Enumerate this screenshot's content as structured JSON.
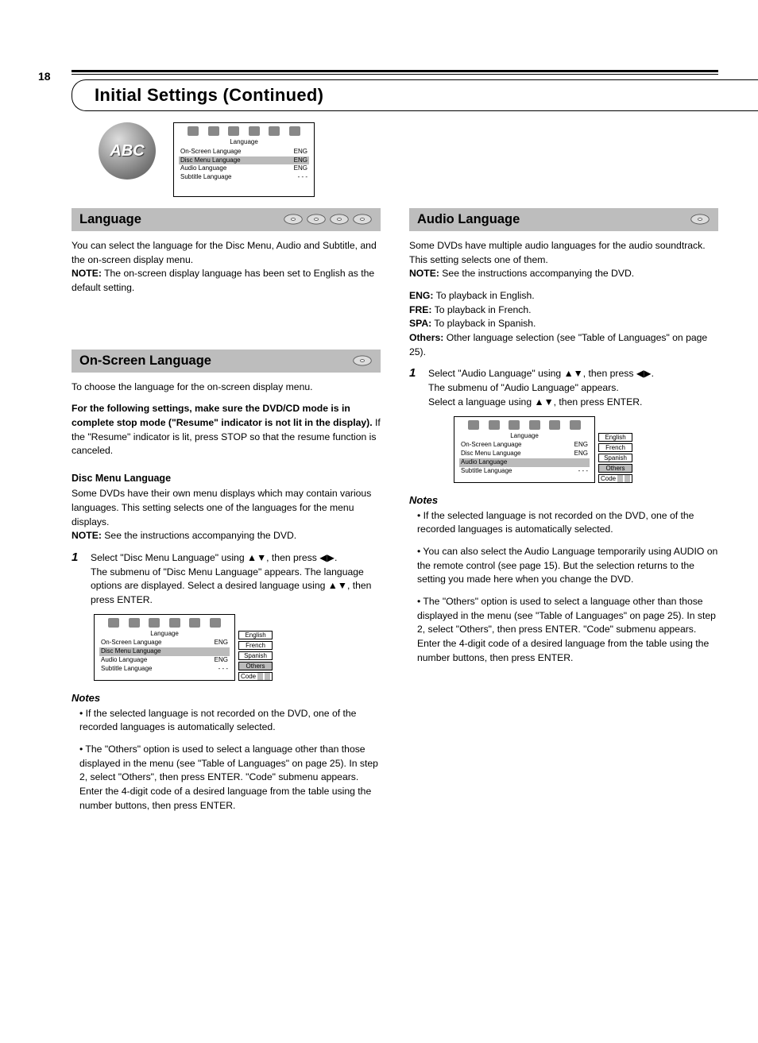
{
  "page_number": "18",
  "section_header": "Initial Settings (Continued)",
  "icon_panel": {
    "abc_label": "ABC",
    "caption": "Language",
    "rows": [
      {
        "label": "On-Screen Language",
        "val": "ENG",
        "hl": false
      },
      {
        "label": "Disc Menu Language",
        "val": "ENG",
        "hl": true
      },
      {
        "label": "Audio Language",
        "val": "ENG",
        "hl": false
      },
      {
        "label": "Subtitle Language",
        "val": "- - -",
        "hl": false
      }
    ]
  },
  "left": {
    "bar1": {
      "title": "Language",
      "categories": 4
    },
    "p1_a": "You can select the language for the Disc Menu, Audio and Subtitle, and the on-screen display menu.",
    "p1_b": "NOTE:",
    "p1_c": " The on-screen display language has been set to English as the default setting.",
    "bar2": {
      "title": "On-Screen Language",
      "categories": 1
    },
    "p2": "To choose the language for the on-screen display menu.",
    "warn_bold1": "For the following settings, make sure the DVD/CD mode is in complete stop mode (\"Resume\" indicator is not lit in the display).",
    "warn_bold2": " If the \"Resume\" indicator is lit, press STOP so that the resume function is canceled.",
    "disc_menu_title": "Disc Menu Language",
    "disc_menu_desc_a": "Some DVDs have their own menu displays which may contain various languages. This setting selects one of the languages for the menu displays.",
    "disc_menu_desc_b": "NOTE:",
    "disc_menu_desc_c": " See the instructions accompanying the DVD.",
    "step": {
      "num": "1",
      "body_a": "Select \"Disc Menu Language\" using ",
      "body_b": ", then press ",
      "body_c": "The submenu of \"Disc Menu Language\" appears. The language options are displayed. Select a desired language using ",
      "body_d": ", then press ENTER."
    },
    "submenu": {
      "caption": "Language",
      "rows": [
        {
          "label": "On-Screen Language",
          "val": "ENG",
          "hl": false
        },
        {
          "label": "Disc Menu Language",
          "val": "",
          "hl": true
        },
        {
          "label": "Audio Language",
          "val": "ENG",
          "hl": false
        },
        {
          "label": "Subtitle Language",
          "val": "- - -",
          "hl": false
        }
      ],
      "options": [
        "English",
        "French",
        "Spanish",
        "Others"
      ],
      "option_hl": "Others",
      "code_label": "Code"
    },
    "notes_heading": "Notes",
    "note1": "• If the selected language is not recorded on the DVD, one of the recorded languages is automatically selected.",
    "note2a": "• The \"Others\" option is used to select a language other than those displayed in the menu (see \"Table of Languages\" on page ",
    "note2b": "25",
    "note2c": "). In step 2, select \"Others\", then press ENTER. \"Code\" submenu appears. Enter the 4-digit code of a desired language from the table using the number buttons, then press ENTER."
  },
  "right": {
    "bar": {
      "title": "Audio Language",
      "categories": 1
    },
    "p1a": "Some DVDs have multiple audio languages for the audio soundtrack. This setting selects one of them.",
    "p1b": "NOTE:",
    "p1c": " See the instructions accompanying the DVD.",
    "legend": {
      "eng_label": "ENG:",
      "eng": "To playback in English.",
      "fre_label": "FRE:",
      "fre": "To playback in French.",
      "spa_label": "SPA:",
      "spa": "To playback in Spanish.",
      "oth_label": "Others:",
      "oth": "Other language selection (see \"Table of Languages\" on page 25)."
    },
    "step": {
      "num": "1",
      "a": "Select \"Audio Language\" using ",
      "b": ", then press ",
      "c": "The submenu of \"Audio Language\" appears.",
      "d": "Select a language using ",
      "e": ", then press ENTER."
    },
    "submenu": {
      "caption": "Language",
      "rows": [
        {
          "label": "On-Screen Language",
          "val": "ENG",
          "hl": false
        },
        {
          "label": "Disc Menu Language",
          "val": "ENG",
          "hl": false
        },
        {
          "label": "Audio Language",
          "val": "",
          "hl": true
        },
        {
          "label": "Subtitle Language",
          "val": "- - -",
          "hl": false
        }
      ],
      "options": [
        "English",
        "French",
        "Spanish",
        "Others"
      ],
      "option_hl": "Others",
      "code_label": "Code"
    },
    "notes_heading": "Notes",
    "note1": "• If the selected language is not recorded on the DVD, one of the recorded languages is automatically selected.",
    "note2": "• You can also select the Audio Language temporarily using AUDIO on the remote control (see page 15). But the selection returns to the setting you made here when you change the DVD.",
    "note3a": "• The \"Others\" option is used to select a language other than those displayed in the menu (see \"Table of Languages\" on page ",
    "note3b": "25",
    "note3c": "). In step 2, select \"Others\", then press ENTER. \"Code\" submenu appears. Enter the 4-digit code of a desired language from the table using the number buttons, then press ENTER."
  }
}
